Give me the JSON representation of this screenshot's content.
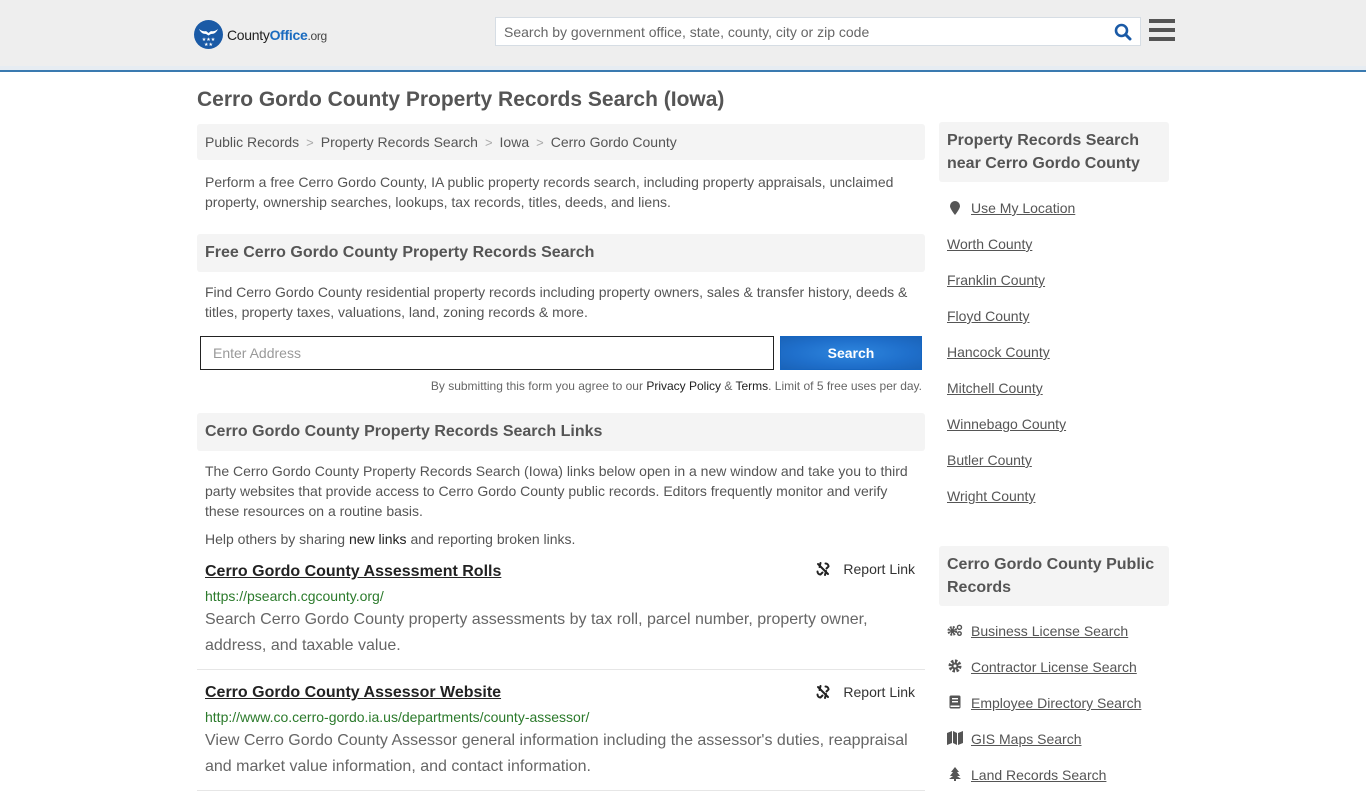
{
  "header": {
    "logo": {
      "county": "County",
      "office": "Office",
      "org": ".org"
    },
    "search_placeholder": "Search by government office, state, county, city or zip code",
    "search_value": ""
  },
  "page_title": "Cerro Gordo County Property Records Search (Iowa)",
  "breadcrumb": [
    {
      "label": "Public Records"
    },
    {
      "label": "Property Records Search"
    },
    {
      "label": "Iowa"
    },
    {
      "label": "Cerro Gordo County"
    }
  ],
  "intro": "Perform a free Cerro Gordo County, IA public property records search, including property appraisals, unclaimed property, ownership searches, lookups, tax records, titles, deeds, and liens.",
  "free_search": {
    "heading": "Free Cerro Gordo County Property Records Search",
    "text": "Find Cerro Gordo County residential property records including property owners, sales & transfer history, deeds & titles, property taxes, valuations, land, zoning records & more.",
    "address_placeholder": "Enter Address",
    "address_value": "",
    "button": "Search",
    "disclaimer": {
      "prefix": "By submitting this form you agree to our ",
      "privacy": "Privacy Policy",
      "amp": " & ",
      "terms": "Terms",
      "suffix": ". Limit of 5 free uses per day."
    }
  },
  "links_section": {
    "heading": "Cerro Gordo County Property Records Search Links",
    "text": "The Cerro Gordo County Property Records Search (Iowa) links below open in a new window and take you to third party websites that provide access to Cerro Gordo County public records. Editors frequently monitor and verify these resources on a routine basis.",
    "help": {
      "prefix": "Help others by sharing ",
      "link": "new links",
      "suffix": " and reporting broken links."
    },
    "report_label": "Report Link",
    "items": [
      {
        "title": "Cerro Gordo County Assessment Rolls",
        "url": "https://psearch.cgcounty.org/",
        "description": "Search Cerro Gordo County property assessments by tax roll, parcel number, property owner, address, and taxable value."
      },
      {
        "title": "Cerro Gordo County Assessor Website",
        "url": "http://www.co.cerro-gordo.ia.us/departments/county-assessor/",
        "description": "View Cerro Gordo County Assessor general information including the assessor's duties, reappraisal and market value information, and contact information."
      }
    ]
  },
  "sidebar": {
    "nearby": {
      "heading": "Property Records Search near Cerro Gordo County",
      "use_location": "Use My Location",
      "counties": [
        "Worth County",
        "Franklin County",
        "Floyd County",
        "Hancock County",
        "Mitchell County",
        "Winnebago County",
        "Butler County",
        "Wright County"
      ]
    },
    "public_records": {
      "heading": "Cerro Gordo County Public Records",
      "items": [
        {
          "label": "Business License Search",
          "icon": "cogs-icon"
        },
        {
          "label": "Contractor License Search",
          "icon": "gear-icon"
        },
        {
          "label": "Employee Directory Search",
          "icon": "book-icon"
        },
        {
          "label": "GIS Maps Search",
          "icon": "map-icon"
        },
        {
          "label": "Land Records Search",
          "icon": "tree-icon"
        }
      ]
    }
  },
  "colors": {
    "accent_blue": "#1f6fcb",
    "header_border": "#3a7ab0",
    "url_green": "#2b7a2b",
    "panel_bg": "#f4f4f4"
  }
}
